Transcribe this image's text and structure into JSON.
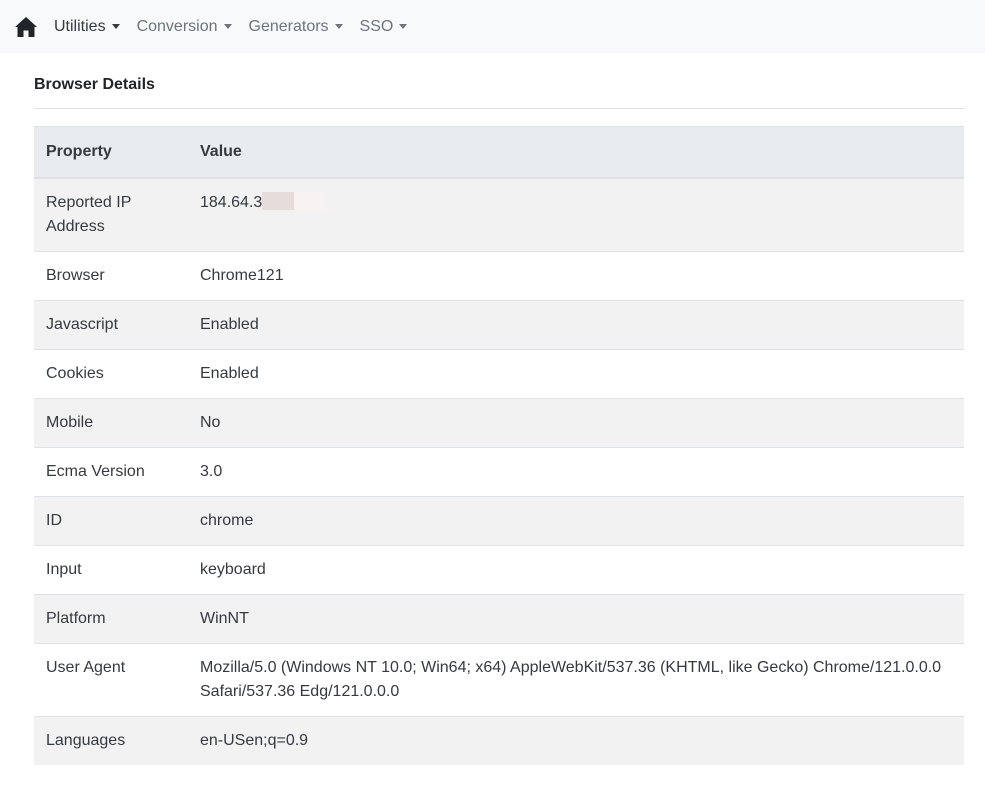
{
  "navbar": {
    "menus": [
      {
        "label": "Utilities",
        "active": true
      },
      {
        "label": "Conversion",
        "active": false
      },
      {
        "label": "Generators",
        "active": false
      },
      {
        "label": "SSO",
        "active": false
      }
    ]
  },
  "section": {
    "title": "Browser Details"
  },
  "table": {
    "headers": [
      "Property",
      "Value"
    ],
    "rows": [
      {
        "property": "Reported IP Address",
        "value": "184.64.3"
      },
      {
        "property": "Browser",
        "value": "Chrome121"
      },
      {
        "property": "Javascript",
        "value": "Enabled"
      },
      {
        "property": "Cookies",
        "value": "Enabled"
      },
      {
        "property": "Mobile",
        "value": "No"
      },
      {
        "property": "Ecma Version",
        "value": "3.0"
      },
      {
        "property": "ID",
        "value": "chrome"
      },
      {
        "property": "Input",
        "value": "keyboard"
      },
      {
        "property": "Platform",
        "value": "WinNT"
      },
      {
        "property": "User Agent",
        "value": "Mozilla/5.0 (Windows NT 10.0; Win64; x64) AppleWebKit/537.36 (KHTML, like Gecko) Chrome/121.0.0.0 Safari/537.36 Edg/121.0.0.0"
      },
      {
        "property": "Languages",
        "value": "en-USen;q=0.9"
      }
    ]
  },
  "icons": {
    "home": "home-icon",
    "caret": "caret-down-icon"
  }
}
